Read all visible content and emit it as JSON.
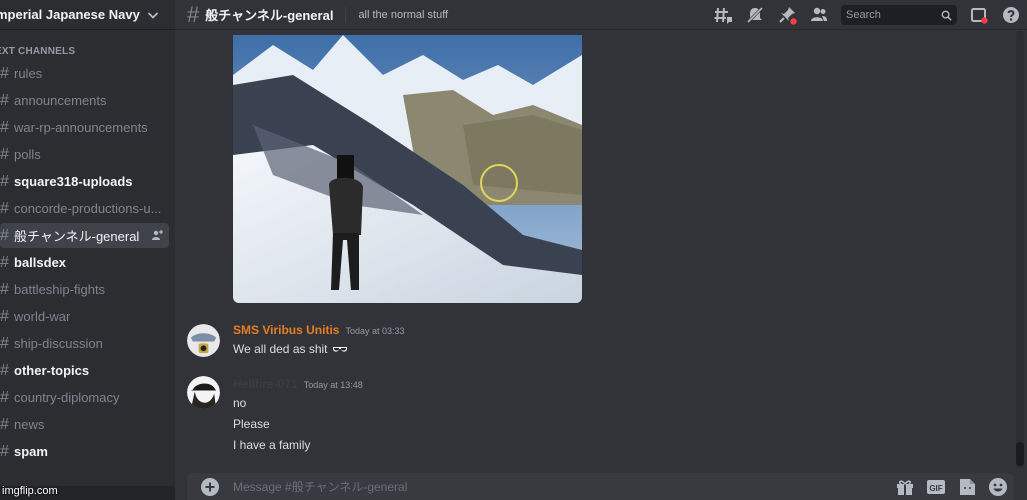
{
  "server": {
    "name": "mperial Japanese Navy"
  },
  "sidebar": {
    "category": "EXT CHANNELS",
    "channels": [
      {
        "name": "rules",
        "state": "read"
      },
      {
        "name": "announcements",
        "state": "read"
      },
      {
        "name": "war-rp-announcements",
        "state": "read"
      },
      {
        "name": "polls",
        "state": "read"
      },
      {
        "name": "square318-uploads",
        "state": "unread"
      },
      {
        "name": "concorde-productions-u...",
        "state": "read"
      },
      {
        "name": "般チャンネル-general",
        "state": "active"
      },
      {
        "name": "ballsdex",
        "state": "unread"
      },
      {
        "name": "battleship-fights",
        "state": "read"
      },
      {
        "name": "world-war",
        "state": "read"
      },
      {
        "name": "ship-discussion",
        "state": "read"
      },
      {
        "name": "other-topics",
        "state": "unread"
      },
      {
        "name": "country-diplomacy",
        "state": "read"
      },
      {
        "name": "news",
        "state": "read"
      },
      {
        "name": "spam",
        "state": "unread"
      }
    ]
  },
  "header": {
    "channel_name": "般チャンネル-general",
    "topic": "all the normal stuff",
    "search_placeholder": "Search",
    "icons": [
      "threads-icon",
      "mute-icon",
      "pins-icon",
      "members-icon",
      "search-icon",
      "inbox-icon",
      "help-icon"
    ]
  },
  "messages": [
    {
      "author": "SMS Viribus Unitis",
      "author_color": "#e67e22",
      "time": "Today at 03:33",
      "lines": [
        "We all ded as shit"
      ]
    },
    {
      "author": "Hellfire-071",
      "author_color": "#3a3c41",
      "time": "Today at 13:48",
      "lines": [
        "no",
        "Please",
        "I have a family"
      ]
    }
  ],
  "composer": {
    "placeholder": "Message #般チャンネル-general",
    "icons": [
      "gift-icon",
      "gif-icon",
      "sticker-icon",
      "emoji-icon"
    ]
  },
  "watermark": "imgflip.com"
}
